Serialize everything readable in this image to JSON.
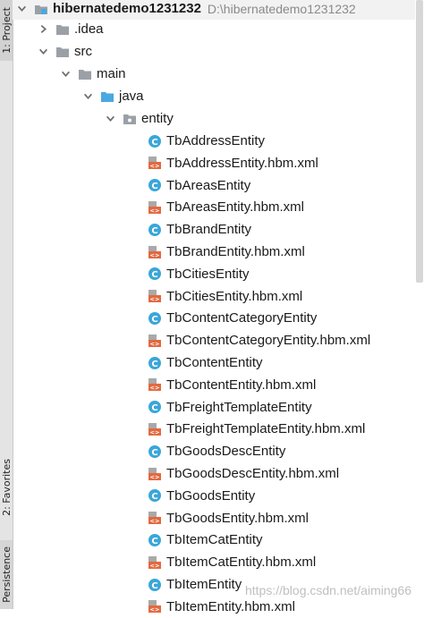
{
  "sidebar": {
    "project_label": "1: Project",
    "favorites_label": "2: Favorites",
    "persistence_label": "Persistence"
  },
  "tree": {
    "project": {
      "name": "hibernatedemo1231232",
      "path": "D:\\hibernatedemo1231232"
    },
    "idea": ".idea",
    "src": "src",
    "main": "main",
    "java": "java",
    "entity": "entity",
    "files": [
      {
        "name": "TbAddressEntity",
        "kind": "class"
      },
      {
        "name": "TbAddressEntity.hbm.xml",
        "kind": "xml"
      },
      {
        "name": "TbAreasEntity",
        "kind": "class"
      },
      {
        "name": "TbAreasEntity.hbm.xml",
        "kind": "xml"
      },
      {
        "name": "TbBrandEntity",
        "kind": "class"
      },
      {
        "name": "TbBrandEntity.hbm.xml",
        "kind": "xml"
      },
      {
        "name": "TbCitiesEntity",
        "kind": "class"
      },
      {
        "name": "TbCitiesEntity.hbm.xml",
        "kind": "xml"
      },
      {
        "name": "TbContentCategoryEntity",
        "kind": "class"
      },
      {
        "name": "TbContentCategoryEntity.hbm.xml",
        "kind": "xml"
      },
      {
        "name": "TbContentEntity",
        "kind": "class"
      },
      {
        "name": "TbContentEntity.hbm.xml",
        "kind": "xml"
      },
      {
        "name": "TbFreightTemplateEntity",
        "kind": "class"
      },
      {
        "name": "TbFreightTemplateEntity.hbm.xml",
        "kind": "xml"
      },
      {
        "name": "TbGoodsDescEntity",
        "kind": "class"
      },
      {
        "name": "TbGoodsDescEntity.hbm.xml",
        "kind": "xml"
      },
      {
        "name": "TbGoodsEntity",
        "kind": "class"
      },
      {
        "name": "TbGoodsEntity.hbm.xml",
        "kind": "xml"
      },
      {
        "name": "TbItemCatEntity",
        "kind": "class"
      },
      {
        "name": "TbItemCatEntity.hbm.xml",
        "kind": "xml"
      },
      {
        "name": "TbItemEntity",
        "kind": "class"
      },
      {
        "name": "TbItemEntity.hbm.xml",
        "kind": "xml"
      }
    ]
  },
  "watermark": "https://blog.csdn.net/aiming66",
  "colors": {
    "class_icon": "#3aa6d9",
    "xml_icon": "#e2693f",
    "folder": "#9aa0a6",
    "source_folder": "#4aa8e0"
  }
}
